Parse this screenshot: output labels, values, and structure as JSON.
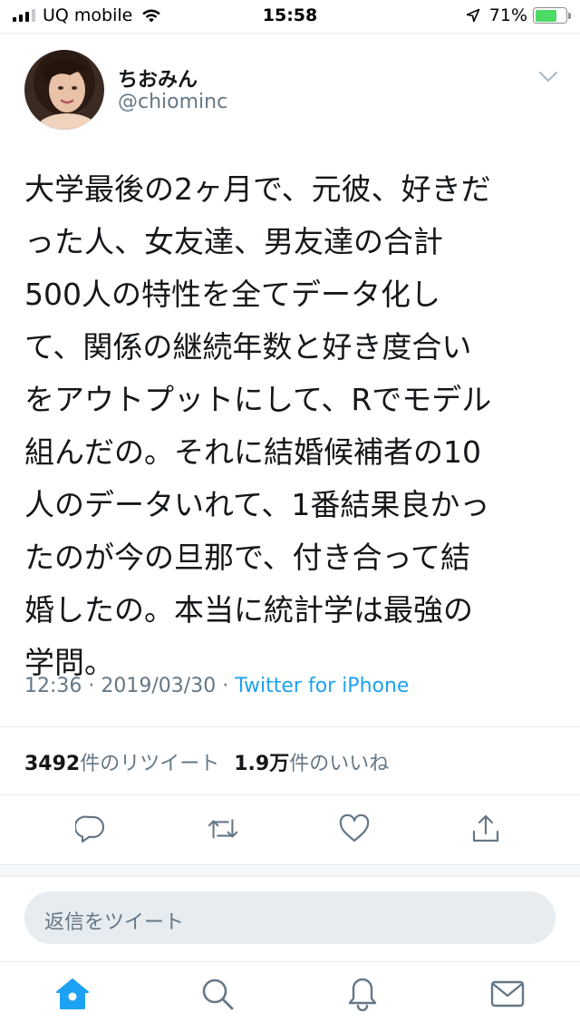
{
  "status_bar": {
    "carrier": "UQ mobile",
    "time": "15:58",
    "battery_percent": "71%",
    "battery_level": 0.71,
    "signal_bars": 3,
    "icons": [
      "signal-icon",
      "wifi-icon",
      "location-arrow-icon",
      "battery-icon"
    ]
  },
  "tweet": {
    "display_name": "ちおみん",
    "handle": "@chiominc",
    "text": "大学最後の2ヶ月で、元彼、好きだ\nった人、女友達、男友達の合計\n500人の特性を全てデータ化し\nて、関係の継続年数と好き度合い\nをアウトプットにして、Rでモデル\n組んだの。それに結婚候補者の10\n人のデータいれて、1番結果良かっ\nたのが今の旦那で、付き合って結\n婚したの。本当に統計学は最強の\n学問。",
    "time": "12:36",
    "date": "2019/03/30",
    "separator": "·",
    "source": "Twitter for iPhone"
  },
  "stats": {
    "retweets_count": "3492",
    "retweets_label": "件のリツイート",
    "likes_count": "1.9万",
    "likes_label": "件のいいね"
  },
  "actions": {
    "icons": [
      "reply-icon",
      "retweet-icon",
      "like-icon",
      "share-icon"
    ]
  },
  "reply": {
    "placeholder": "返信をツイート"
  },
  "tabbar": {
    "icons": [
      "home-icon",
      "search-icon",
      "notifications-icon",
      "messages-icon"
    ],
    "active": "home-icon"
  },
  "colors": {
    "accent": "#1da1f2",
    "text": "#14171a",
    "secondary": "#657786",
    "battery": "#4cd964",
    "divider": "#e6ecf0",
    "input_bg": "#e6ecf0"
  }
}
